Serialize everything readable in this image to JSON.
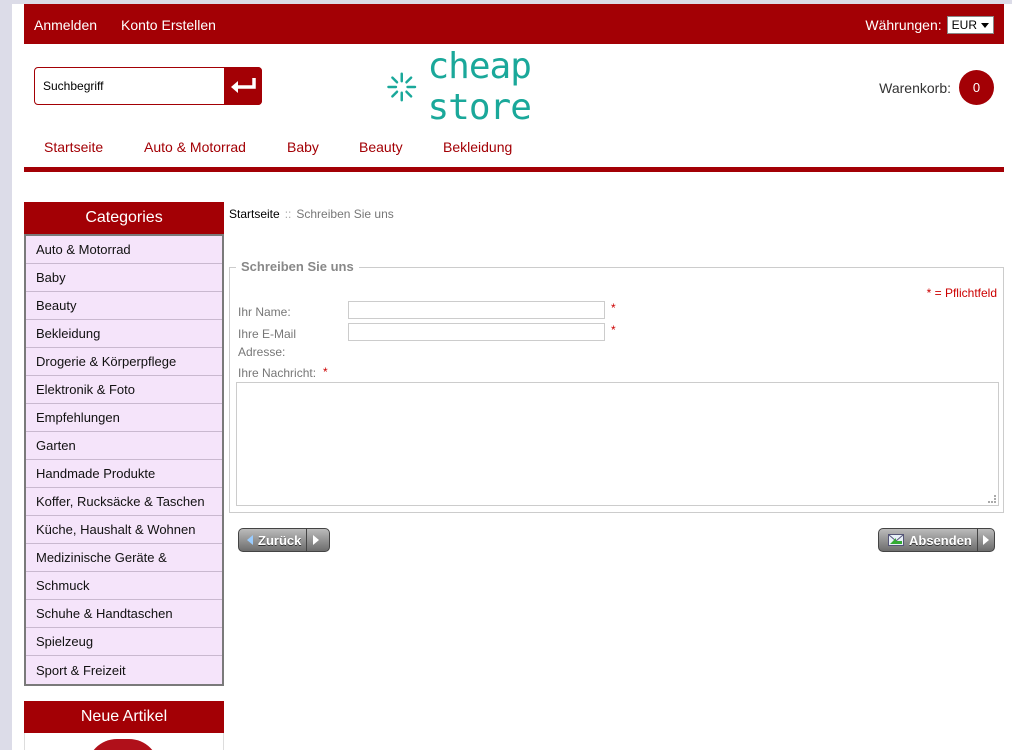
{
  "header": {
    "login": "Anmelden",
    "register": "Konto Erstellen",
    "currency_label": "Währungen:",
    "currency_value": "EUR"
  },
  "search": {
    "placeholder": "Suchbegriff"
  },
  "logo": {
    "text": "cheap store"
  },
  "cart": {
    "label": "Warenkorb:",
    "count": "0"
  },
  "nav": [
    "Startseite",
    "Auto & Motorrad",
    "Baby",
    "Beauty",
    "Bekleidung"
  ],
  "sidebar": {
    "title": "Categories",
    "items": [
      "Auto & Motorrad",
      "Baby",
      "Beauty",
      "Bekleidung",
      "Drogerie & Körperpflege",
      "Elektronik & Foto",
      "Empfehlungen",
      "Garten",
      "Handmade Produkte",
      "Koffer, Rucksäcke & Taschen",
      "Küche, Haushalt & Wohnen",
      "Medizinische Geräte &",
      "Schmuck",
      "Schuhe & Handtaschen",
      "Spielzeug",
      "Sport & Freizeit"
    ],
    "new_title": "Neue Artikel"
  },
  "breadcrumb": {
    "home": "Startseite",
    "separator": "::",
    "current": "Schreiben Sie uns"
  },
  "form": {
    "legend": "Schreiben Sie uns",
    "required_note": "* = Pflichtfeld",
    "name_label": "Ihr Name:",
    "email_label": "Ihre E-Mail Adresse:",
    "message_label": "Ihre Nachricht:",
    "required_mark": "*"
  },
  "buttons": {
    "back": "Zurück",
    "send": "Absenden"
  },
  "colors": {
    "brand": "#a30005",
    "logo": "#1aa89a",
    "sidebar_bg": "#f5e4fa"
  }
}
